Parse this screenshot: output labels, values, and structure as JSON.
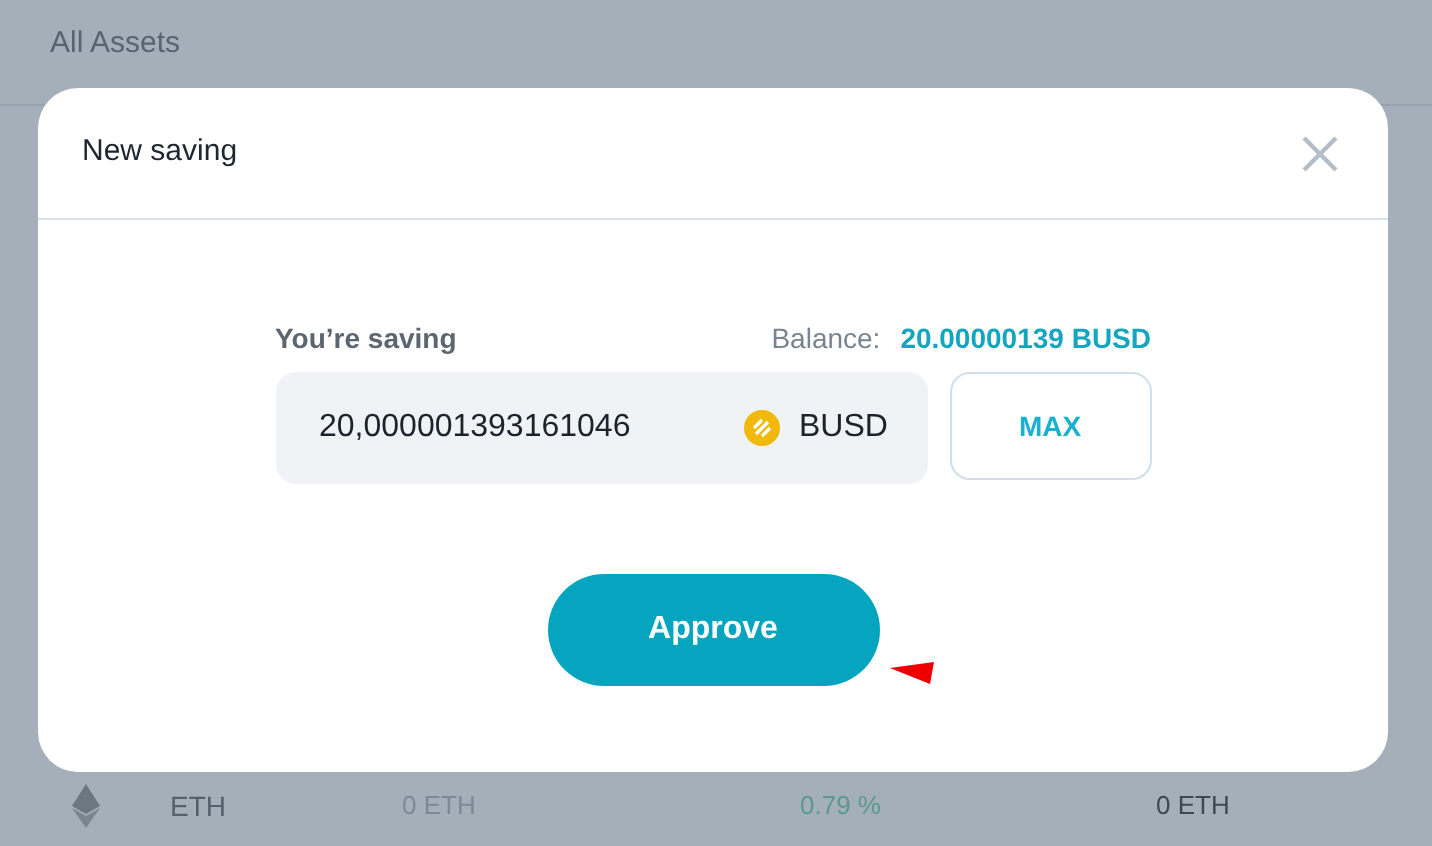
{
  "page": {
    "title": "All Assets",
    "asset_row": {
      "name": "ETH",
      "balance": "0 ETH",
      "rate": "0.79 %",
      "earned": "0 ETH"
    }
  },
  "dialog": {
    "title": "New saving",
    "amount_label": "You’re saving",
    "balance_label": "Balance:",
    "balance_value": "20.00000139 BUSD",
    "amount_field": {
      "value": "20,000001393161046",
      "currency": "BUSD"
    },
    "max_button": "MAX",
    "approve_button": "Approve",
    "pointer_mark": true
  }
}
